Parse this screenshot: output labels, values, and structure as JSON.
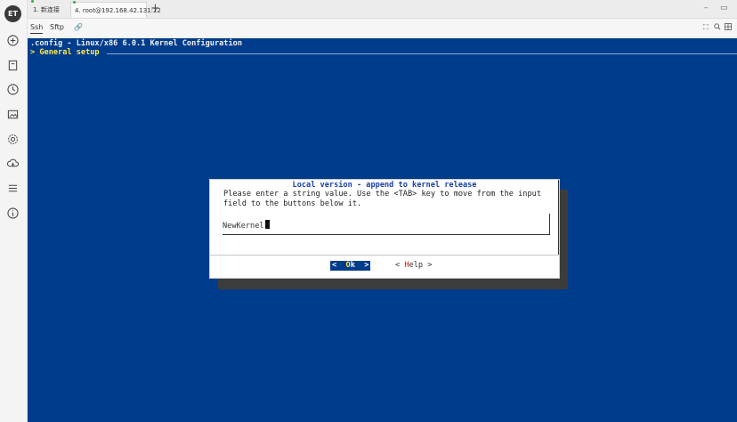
{
  "rail": {
    "logo": "ET"
  },
  "tabs": [
    {
      "label": "1. 新连接"
    },
    {
      "label": "4. root@192.168.42.131:22"
    }
  ],
  "add_tab": "+",
  "window_controls": {
    "minimize": "–",
    "restore": "▭"
  },
  "subtabs": {
    "ssh": "Ssh",
    "sftp": "Sftp",
    "attach": "🔗"
  },
  "terminal": {
    "title_line": ".config - Linux/x86 6.0.1 Kernel Configuration",
    "breadcrumb": "> General setup",
    "colors": {
      "background": "#003c8c",
      "title": "#f0f0f0",
      "breadcrumb": "#ffe94a"
    }
  },
  "dialog": {
    "title": "Local version - append to kernel release",
    "body": "Please enter a string value. Use the <TAB> key to move from the input\nfield to the buttons below it.",
    "input_value": "NewKernel",
    "ok_prefix": "<  ",
    "ok_hot": "O",
    "ok_rest": "k  >",
    "help_prefix": "< ",
    "help_hot": "H",
    "help_rest": "elp >"
  }
}
